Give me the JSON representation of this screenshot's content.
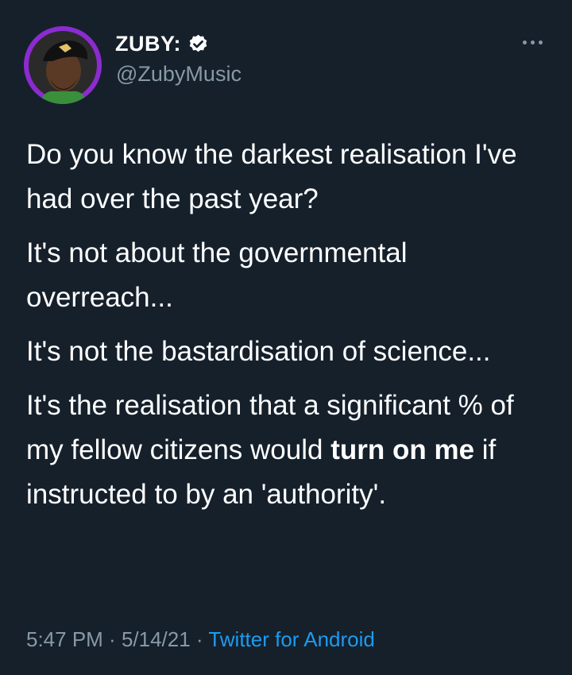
{
  "colors": {
    "background": "#15202b",
    "text_primary": "#ffffff",
    "text_secondary": "#8899a6",
    "link": "#1d9bf0",
    "avatar_ring": "#8b2bd0"
  },
  "author": {
    "display_name": "ZUBY:",
    "handle": "@ZubyMusic",
    "verified_icon": "verified-badge-icon",
    "avatar_icon": "user-avatar"
  },
  "more_icon": "more-options-icon",
  "tweet": {
    "p1": "Do you know the darkest realisation I've had over the past year?",
    "p2": "It's not about the governmental overreach...",
    "p3": "It's not the bastardisation of science...",
    "p4_before": "It's the realisation that a significant % of my fellow citizens would ",
    "p4_bold": "turn on me",
    "p4_after": " if instructed to by an 'authority'."
  },
  "meta": {
    "time": "5:47 PM",
    "sep1": " · ",
    "date": "5/14/21",
    "sep2": " · ",
    "source": "Twitter for Android"
  }
}
